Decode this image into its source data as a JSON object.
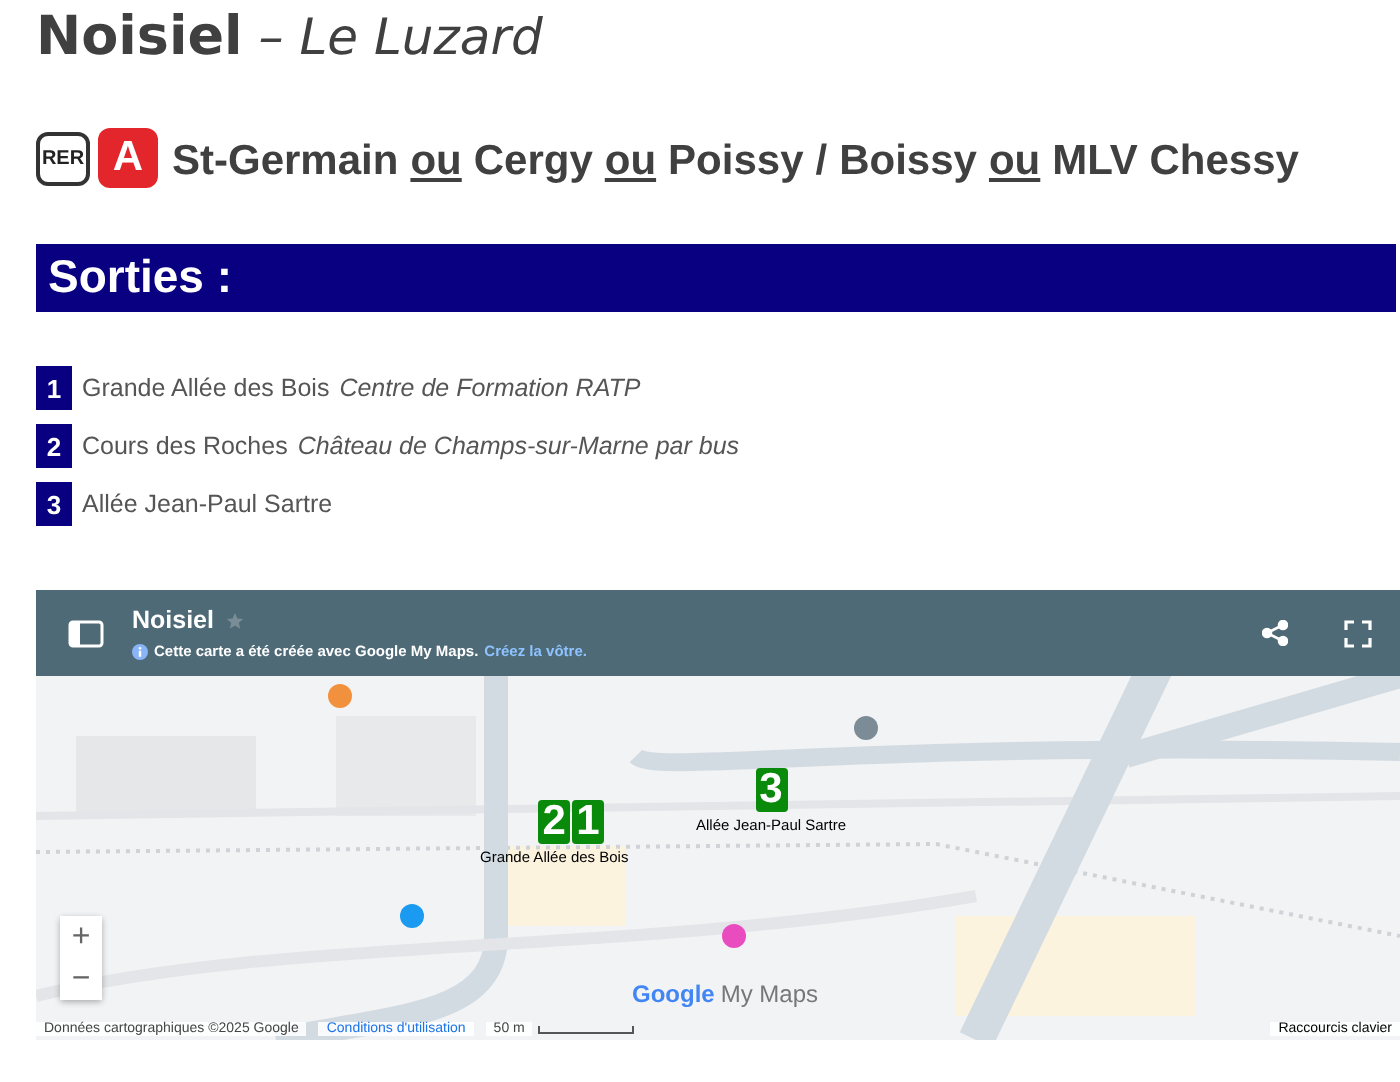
{
  "title": {
    "place": "Noisiel",
    "subtitle": "– Le Luzard"
  },
  "line": {
    "mode": "RER",
    "letter": "A",
    "parts": [
      {
        "kind": "station",
        "text": "St-Germain"
      },
      {
        "kind": "or",
        "text": "ou"
      },
      {
        "kind": "station",
        "text": "Cergy"
      },
      {
        "kind": "or",
        "text": "ou"
      },
      {
        "kind": "station",
        "text": "Poissy"
      },
      {
        "kind": "slash",
        "text": "/"
      },
      {
        "kind": "station",
        "text": "Boissy"
      },
      {
        "kind": "or",
        "text": "ou"
      },
      {
        "kind": "station",
        "text": "MLV Chessy"
      }
    ]
  },
  "exits_heading": "Sorties :",
  "exits": [
    {
      "number": "1",
      "name": "Grande Allée des Bois",
      "note": "Centre de Formation RATP"
    },
    {
      "number": "2",
      "name": "Cours des Roches",
      "note": "Château de Champs-sur-Marne par bus"
    },
    {
      "number": "3",
      "name": "Allée Jean-Paul Sartre"
    }
  ],
  "map": {
    "title": "Noisiel",
    "info": "Cette carte a été créée avec Google My Maps.",
    "info_link": "Créez la vôtre.",
    "markers": [
      {
        "number": "2",
        "label": "Grande Allée des Bois"
      },
      {
        "number": "1"
      },
      {
        "number": "3",
        "label": "Allée Jean-Paul Sartre"
      }
    ],
    "zoom_in": "+",
    "zoom_out": "−",
    "logo": "Google",
    "logo_suffix": "My Maps",
    "attribution": "Données cartographiques ©2025 Google",
    "terms": "Conditions d'utilisation",
    "scale": "50 m",
    "shortcuts": "Raccourcis clavier"
  }
}
